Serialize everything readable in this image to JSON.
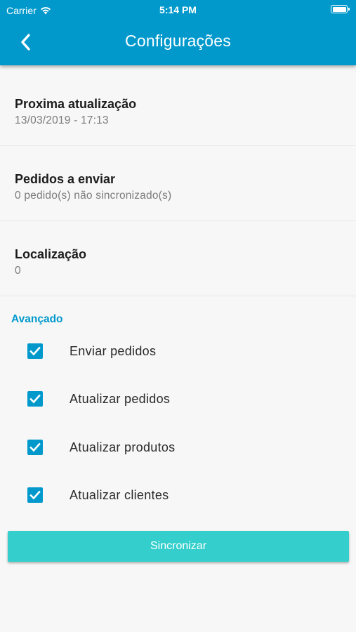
{
  "status_bar": {
    "carrier": "Carrier",
    "time": "5:14 PM"
  },
  "header": {
    "title": "Configurações",
    "back_icon": "chevron-left-icon"
  },
  "sections": [
    {
      "label": "Proxima atualização",
      "value": "13/03/2019 - 17:13"
    },
    {
      "label": "Pedidos a enviar",
      "value": "0 pedido(s) não sincronizado(s)"
    },
    {
      "label": "Localização",
      "value": "0"
    }
  ],
  "advanced": {
    "title": "Avançado",
    "options": [
      {
        "label": "Enviar pedidos",
        "checked": true
      },
      {
        "label": "Atualizar pedidos",
        "checked": true
      },
      {
        "label": "Atualizar produtos",
        "checked": true
      },
      {
        "label": "Atualizar clientes",
        "checked": true
      }
    ]
  },
  "sync_button": {
    "label": "Sincronizar"
  },
  "colors": {
    "primary": "#0199cc",
    "button": "#34cfcc",
    "background": "#f7f7f7"
  }
}
